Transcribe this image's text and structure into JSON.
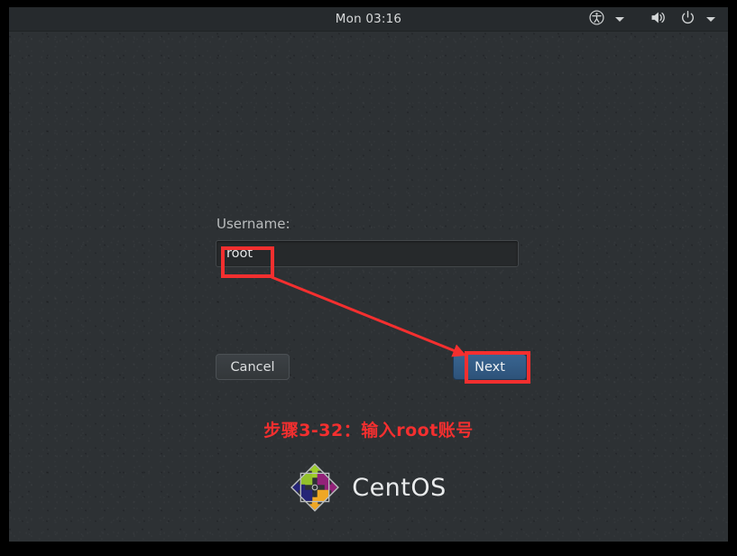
{
  "window": {
    "frame_color": "#000000",
    "desktop_bg": "#2d3134"
  },
  "topbar": {
    "clock": "Mon 03:16",
    "accessibility_icon": "accessibility-icon",
    "accessibility_chevron": "chevron-down-icon",
    "volume_icon": "volume-icon",
    "power_icon": "power-icon",
    "power_chevron": "chevron-down-icon"
  },
  "login": {
    "username_label": "Username:",
    "username_value": "root",
    "username_placeholder": "",
    "cancel_label": "Cancel",
    "next_label": "Next",
    "next_button_color": "#336391"
  },
  "annotations": {
    "accent_color": "#f42f2f",
    "caption": "步骤3-32：输入root账号",
    "box_username_target": "username-input",
    "box_next_target": "next-button",
    "arrow_name": "pointer-arrow"
  },
  "brand": {
    "name": "CentOS",
    "logo_colors": {
      "top": "#9ccd2a",
      "right": "#932279",
      "bottom": "#efa724",
      "left": "#262577"
    }
  }
}
